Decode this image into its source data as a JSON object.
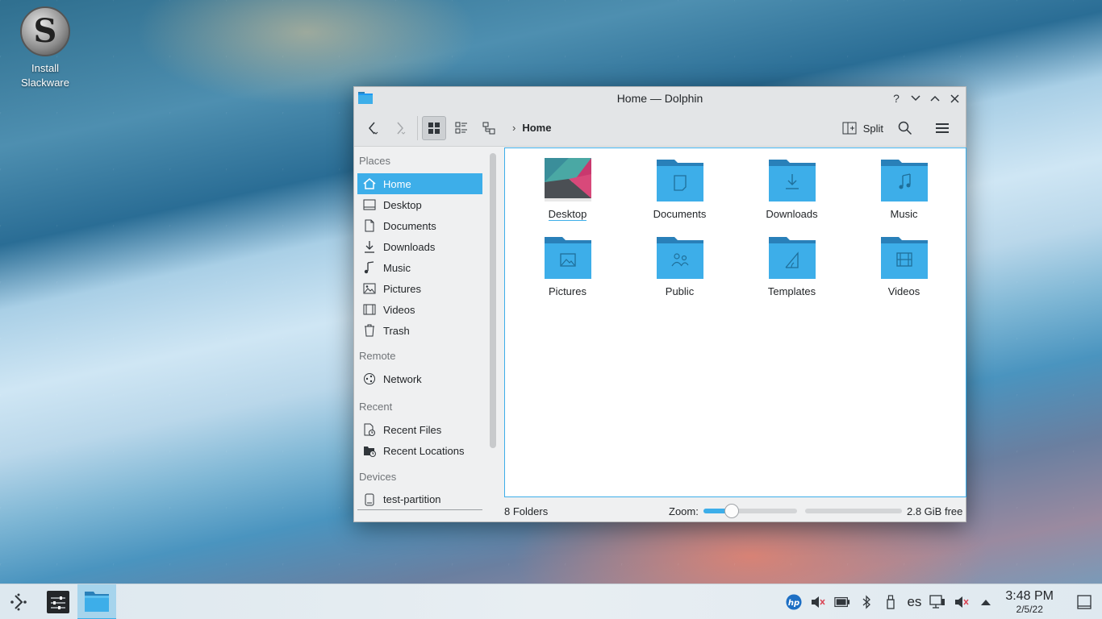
{
  "desktop": {
    "icon_label": "Install Slackware",
    "icon_glyph": "S"
  },
  "window": {
    "title": "Home — Dolphin",
    "toolbar": {
      "breadcrumb": "Home",
      "split_label": "Split"
    },
    "places": {
      "sections": {
        "places": "Places",
        "remote": "Remote",
        "recent": "Recent",
        "devices": "Devices"
      },
      "items": [
        "Home",
        "Desktop",
        "Documents",
        "Downloads",
        "Music",
        "Pictures",
        "Videos",
        "Trash"
      ],
      "remote_items": [
        "Network"
      ],
      "recent_items": [
        "Recent Files",
        "Recent Locations"
      ],
      "device_items": [
        "test-partition"
      ]
    },
    "files": [
      "Desktop",
      "Documents",
      "Downloads",
      "Music",
      "Pictures",
      "Public",
      "Templates",
      "Videos"
    ],
    "status": {
      "folders": "8 Folders",
      "zoom_label": "Zoom:",
      "zoom_level": 0.27,
      "free_space": "2.8 GiB free",
      "space_used_fraction": 0.0
    }
  },
  "taskbar": {
    "language": "es",
    "time": "3:48 PM",
    "date": "2/5/22"
  },
  "colors": {
    "accent": "#3daee9",
    "folder": "#3daee9",
    "folder_tab": "#2980b9"
  }
}
